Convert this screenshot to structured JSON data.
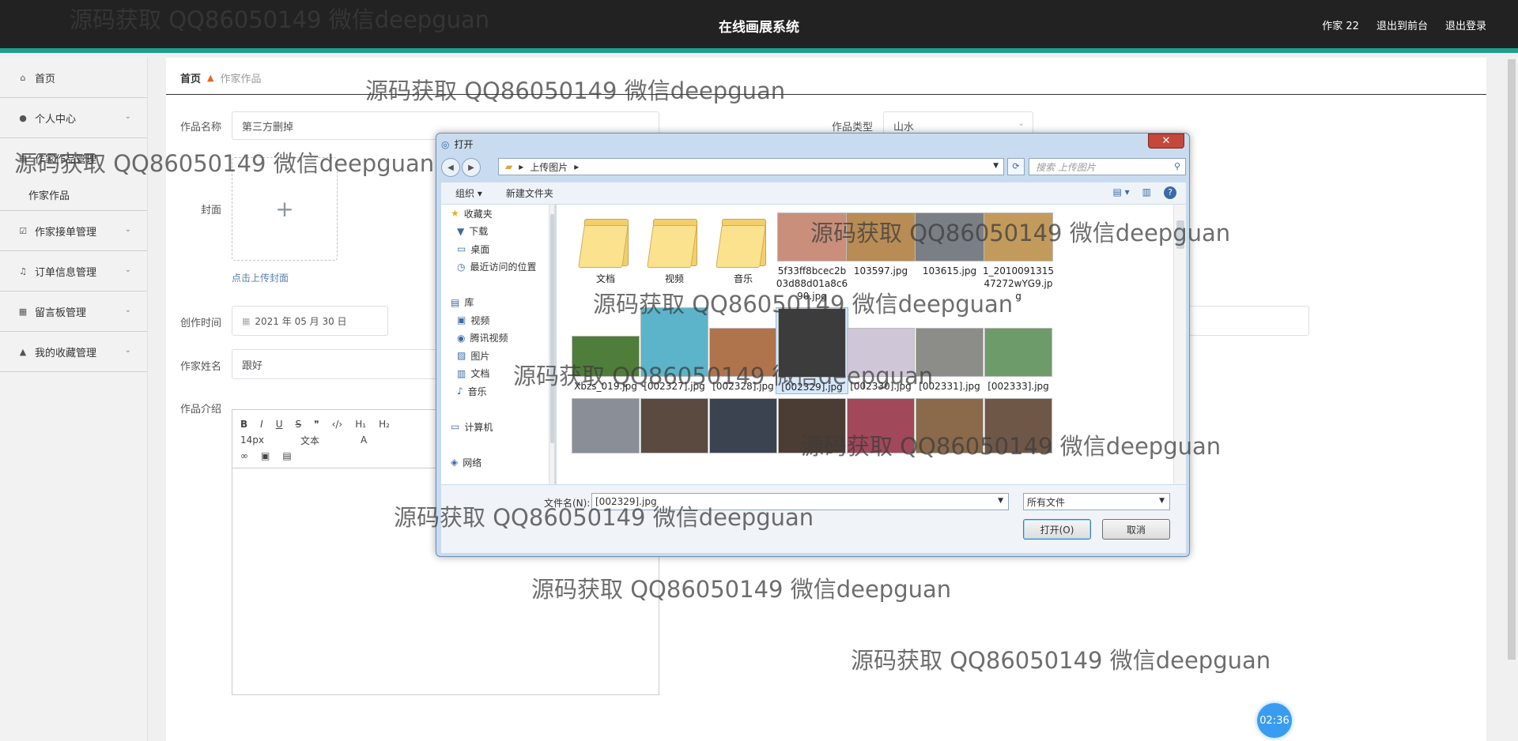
{
  "header": {
    "title": "在线画展系统",
    "user": "作家 22",
    "back_front": "退出到前台",
    "logout": "退出登录"
  },
  "sidebar": {
    "items": [
      {
        "label": "首页",
        "icon": "home-icon"
      },
      {
        "label": "个人中心",
        "icon": "user-icon"
      },
      {
        "label": "作家作品管理",
        "icon": "grid-icon",
        "sub": [
          "作家作品"
        ]
      },
      {
        "label": "作家接单管理",
        "icon": "checkbox-icon"
      },
      {
        "label": "订单信息管理",
        "icon": "bell-icon"
      },
      {
        "label": "留言板管理",
        "icon": "grid-icon"
      },
      {
        "label": "我的收藏管理",
        "icon": "thumb-icon"
      }
    ]
  },
  "breadcrumb": {
    "home": "首页",
    "current": "作家作品"
  },
  "form": {
    "name_label": "作品名称",
    "name_value": "第三方删掉",
    "type_label": "作品类型",
    "type_value": "山水",
    "cover_label": "封面",
    "cover_hint": "点击上传封面",
    "time_label": "创作时间",
    "time_value": "2021 年 05 月 30 日",
    "author_label": "作家姓名",
    "author_value": "跟好",
    "intro_label": "作品介绍"
  },
  "editor": {
    "font_size": "14px",
    "font_type": "文本"
  },
  "dialog": {
    "title": "打开",
    "path": "上传图片",
    "search_placeholder": "搜索 上传图片",
    "organize": "组织 ▾",
    "new_folder": "新建文件夹",
    "tree": [
      {
        "label": "收藏夹",
        "top": true
      },
      {
        "label": "下载"
      },
      {
        "label": "桌面"
      },
      {
        "label": "最近访问的位置"
      },
      {
        "label": "",
        "spacer": true
      },
      {
        "label": "库",
        "top": true
      },
      {
        "label": "视频"
      },
      {
        "label": "腾讯视频"
      },
      {
        "label": "图片"
      },
      {
        "label": "文档"
      },
      {
        "label": "音乐"
      },
      {
        "label": "",
        "spacer": true
      },
      {
        "label": "计算机",
        "top": true
      },
      {
        "label": "",
        "spacer": true
      },
      {
        "label": "网络",
        "top": true
      }
    ],
    "files": [
      {
        "name": "文档",
        "kind": "folder"
      },
      {
        "name": "视频",
        "kind": "folder"
      },
      {
        "name": "音乐",
        "kind": "folder"
      },
      {
        "name": "5f33ff8bcec2b03d88d01a8c690.jpg",
        "kind": "image",
        "color": "#c98f7a"
      },
      {
        "name": "103597.jpg",
        "kind": "image",
        "color": "#b98c55"
      },
      {
        "name": "103615.jpg",
        "kind": "image",
        "color": "#7a7f86"
      },
      {
        "name": "1_201009131547272wYG9.jpg",
        "kind": "image",
        "color": "#c29a5c"
      },
      {
        "name": "Xbzs_019.jpg",
        "kind": "image",
        "color": "#4f7d3a"
      },
      {
        "name": "[002327].jpg",
        "kind": "image",
        "color": "#5bb4c9"
      },
      {
        "name": "[002328].jpg",
        "kind": "image",
        "color": "#b0744d"
      },
      {
        "name": "[002329].jpg",
        "kind": "image",
        "color": "#3c3c3c",
        "selected": true
      },
      {
        "name": "[002330].jpg",
        "kind": "image",
        "color": "#cfc7d8"
      },
      {
        "name": "[002331].jpg",
        "kind": "image",
        "color": "#8c8d88"
      },
      {
        "name": "[002333].jpg",
        "kind": "image",
        "color": "#6e9b6a"
      },
      {
        "name": "",
        "kind": "image",
        "color": "#8a8f97"
      },
      {
        "name": "",
        "kind": "image",
        "color": "#5a4a40"
      },
      {
        "name": "",
        "kind": "image",
        "color": "#3b4350"
      },
      {
        "name": "",
        "kind": "image",
        "color": "#4b3c34"
      },
      {
        "name": "",
        "kind": "image",
        "color": "#a1485a"
      },
      {
        "name": "",
        "kind": "image",
        "color": "#8a6a4a"
      },
      {
        "name": "",
        "kind": "image",
        "color": "#6f5748"
      }
    ],
    "filename_label": "文件名(N):",
    "filename_value": "[002329].jpg",
    "filetype_value": "所有文件",
    "open_btn": "打开(O)",
    "cancel_btn": "取消"
  },
  "watermark": "源码获取 QQ86050149 微信deepguan",
  "clock": "02:36",
  "colors": {
    "accent": "#1e9e8e",
    "header_bg": "#222222",
    "clock": "#3a9cf0"
  }
}
